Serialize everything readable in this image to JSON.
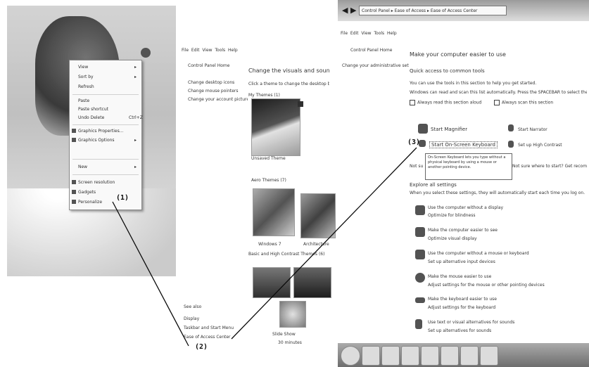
{
  "desktop": {
    "context_menu": {
      "items": [
        {
          "label": "View",
          "submenu": true
        },
        {
          "label": "Sort by",
          "submenu": true
        },
        {
          "label": "Refresh",
          "submenu": false
        },
        {
          "label": "Paste",
          "submenu": false
        },
        {
          "label": "Paste shortcut",
          "submenu": false
        },
        {
          "label": "Undo Delete",
          "shortcut": "Ctrl+Z"
        },
        {
          "label": "Graphics Properties...",
          "submenu": false
        },
        {
          "label": "Graphics Options",
          "submenu": true
        },
        {
          "label": "New",
          "submenu": true
        },
        {
          "label": "Screen resolution",
          "icon": "monitor-icon"
        },
        {
          "label": "Gadgets",
          "icon": "gadgets-icon"
        },
        {
          "label": "Personalize",
          "icon": "personalize-icon"
        }
      ]
    }
  },
  "personalization": {
    "menu": [
      "File",
      "Edit",
      "View",
      "Tools",
      "Help"
    ],
    "left_links": [
      "Control Panel Home",
      "Change desktop icons",
      "Change mouse pointers",
      "Change your account picture"
    ],
    "heading": "Change the visuals and sounds on your computer",
    "sub": "Click a theme to change the desktop background, window color, sounds, and screen saver all at once.",
    "my_themes": "My Themes (1)",
    "unsaved_theme": "Unsaved Theme",
    "aero_themes": "Aero Themes (7)",
    "theme_windows7": "Windows 7",
    "theme_architecture": "Architecture",
    "basic_themes": "Basic and High Contrast Themes (6)",
    "see_also": "See also",
    "see_display": "Display",
    "see_taskbar": "Taskbar and Start Menu",
    "see_ease": "Ease of Access Center",
    "footer_label": "Slide Show",
    "footer_sub": "30 minutes"
  },
  "ease": {
    "breadcrumb": "Control Panel ▸ Ease of Access ▸ Ease of Access Center",
    "menu": [
      "File",
      "Edit",
      "View",
      "Tools",
      "Help"
    ],
    "left_links": [
      "Control Panel Home",
      "Change your administrative settings"
    ],
    "heading": "Make your computer easier to use",
    "quick_title": "Quick access to common tools",
    "quick_desc1": "You can use the tools in this section to help you get started.",
    "quick_desc2": "Windows can read and scan this list automatically. Press the SPACEBAR to select the highlighted tool.",
    "check_read": "Always read this section aloud",
    "check_scan": "Always scan this section",
    "tools": [
      {
        "label": "Start Magnifier",
        "icon": "magnifier-icon"
      },
      {
        "label": "Start Narrator",
        "icon": "narrator-icon"
      },
      {
        "label": "Start On-Screen Keyboard",
        "icon": "keyboard-icon"
      },
      {
        "label": "Set up High Contrast",
        "icon": "contrast-icon"
      }
    ],
    "tooltip_text": "On-Screen Keyboard lets you type without a physical keyboard by using a mouse or another pointing device.",
    "not_sure_link": "Not sure where to start? Get recommendations to make your computer easier to use",
    "explore_title": "Explore all settings",
    "explore_desc": "When you select these settings, they will automatically start each time you log on.",
    "settings": [
      {
        "title": "Use the computer without a display",
        "sub": "Optimize for blindness"
      },
      {
        "title": "Make the computer easier to see",
        "sub": "Optimize visual display"
      },
      {
        "title": "Use the computer without a mouse or keyboard",
        "sub": "Set up alternative input devices"
      },
      {
        "title": "Make the mouse easier to use",
        "sub": "Adjust settings for the mouse or other pointing devices"
      },
      {
        "title": "Make the keyboard easier to use",
        "sub": "Adjust settings for the keyboard"
      },
      {
        "title": "Use text or visual alternatives for sounds",
        "sub": "Set up alternatives for sounds"
      }
    ]
  },
  "callouts": {
    "c1": "(1)",
    "c2": "(2)",
    "c3": "(3)"
  }
}
